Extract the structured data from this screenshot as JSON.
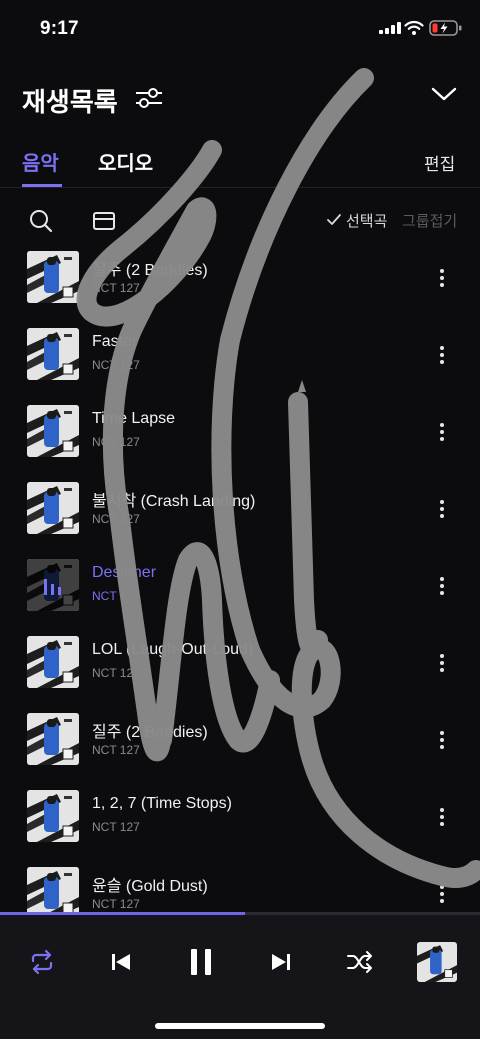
{
  "status_bar": {
    "time": "9:17"
  },
  "header": {
    "title": "재생목록"
  },
  "tabs": {
    "music": "음악",
    "audio": "오디오",
    "edit": "편집"
  },
  "toolbar": {
    "selected": "선택곡",
    "group": "그룹접기"
  },
  "songs": [
    {
      "title": "질주 (2 Baddies)",
      "artist": "NCT 127"
    },
    {
      "title": "Faster",
      "artist": "NCT 127"
    },
    {
      "title": "Time Lapse",
      "artist": "NCT 127"
    },
    {
      "title": "불시착 (Crash Landing)",
      "artist": "NCT 127"
    },
    {
      "title": "Designer",
      "artist": "NCT 127"
    },
    {
      "title": "LOL (Laugh-Out-Loud)",
      "artist": "NCT 127"
    },
    {
      "title": "질주 (2 Baddies)",
      "artist": "NCT 127"
    },
    {
      "title": "1, 2, 7 (Time Stops)",
      "artist": "NCT 127"
    },
    {
      "title": "윤슬 (Gold Dust)",
      "artist": "NCT 127"
    }
  ],
  "player": {
    "progress": 0.51
  },
  "colors": {
    "accent": "#7b72f2",
    "background": "#0c0b0e",
    "signature": "#8a8a8a"
  },
  "icons": [
    "filter-sliders-icon",
    "chevron-down-icon",
    "search-icon",
    "select-box-icon",
    "check-icon",
    "more-vertical-icon",
    "repeat-icon",
    "previous-icon",
    "pause-icon",
    "next-icon",
    "shuffle-icon",
    "album-art-icon",
    "equalizer-icon"
  ]
}
